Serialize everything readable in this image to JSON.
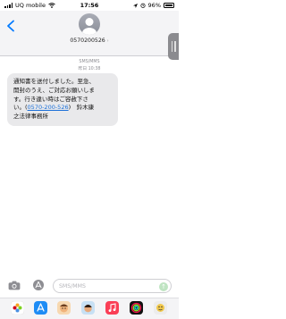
{
  "status": {
    "carrier": "UQ mobile",
    "time": "17:56",
    "battery": "96%"
  },
  "header": {
    "contact": "0570200526",
    "chevron": "›"
  },
  "thread": {
    "service": "SMS/MMS",
    "timestamp": "昨日 10:38"
  },
  "message": {
    "line1": "通知書を送付しました。至急、",
    "line2": "開封のうえ、ご対応お願いしま",
    "line3": "す。行き違い時はご容赦下さ",
    "line4_prefix": "い。(",
    "phone_link": "0570-200-526",
    "line4_suffix": ")　鈴木康",
    "line5": "之法律事務所"
  },
  "composer": {
    "placeholder": "SMS/MMS",
    "send_glyph": "↑"
  },
  "colors": {
    "link": "#1a6fd8",
    "bubble": "#e9e9eb",
    "accent": "#007aff"
  },
  "apps": [
    "photos-app-icon",
    "appstore-app-icon",
    "memoji-app-icon",
    "music-app-icon",
    "fitness-app-icon",
    "memoji-2-app-icon",
    "game-app-icon"
  ]
}
